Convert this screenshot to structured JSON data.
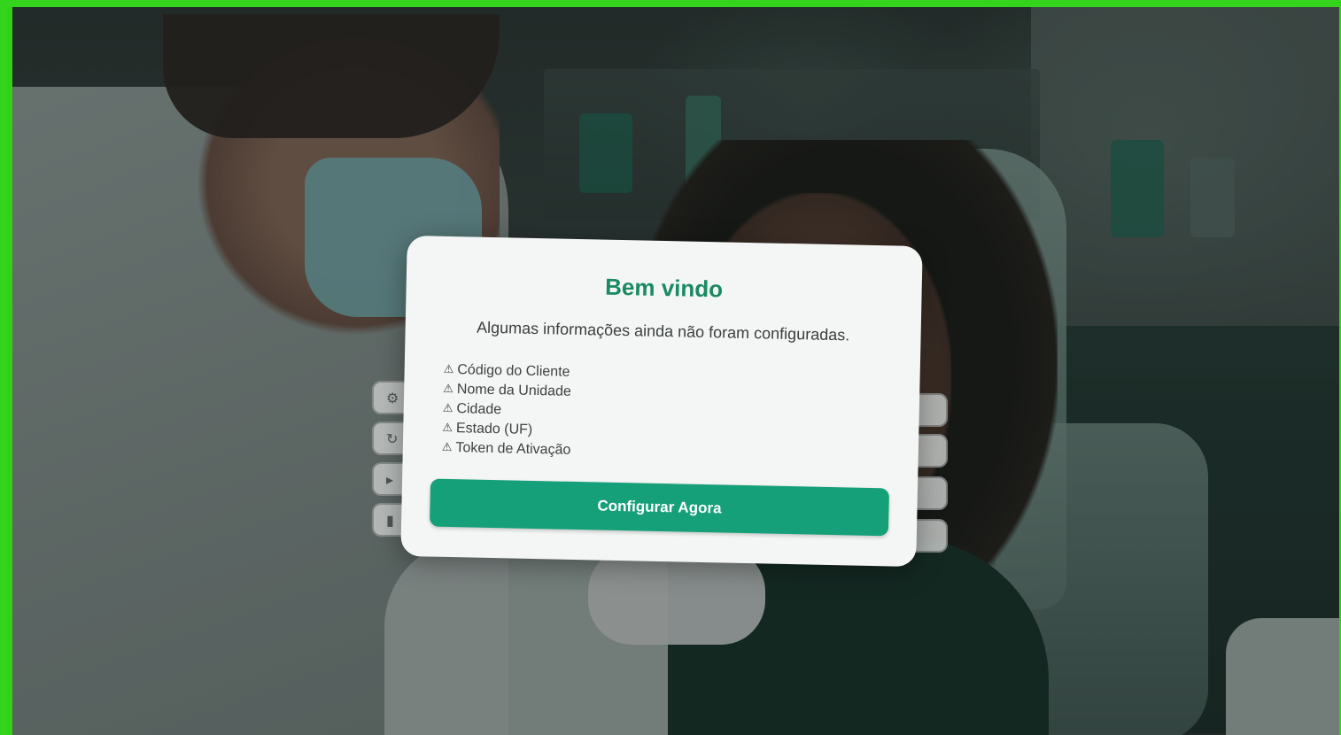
{
  "welcome_dialog": {
    "title": "Bem vindo",
    "subtitle": "Algumas informações ainda não foram configuradas.",
    "warning_glyph": "⚠",
    "missing_items": [
      "Código do Cliente",
      "Nome da Unidade",
      "Cidade",
      "Estado (UF)",
      "Token de Ativação"
    ],
    "configure_button_label": "Configurar Agora"
  },
  "colors": {
    "accent": "#1b8a63",
    "button": "#16a07a",
    "frame_border": "#34d41c"
  }
}
